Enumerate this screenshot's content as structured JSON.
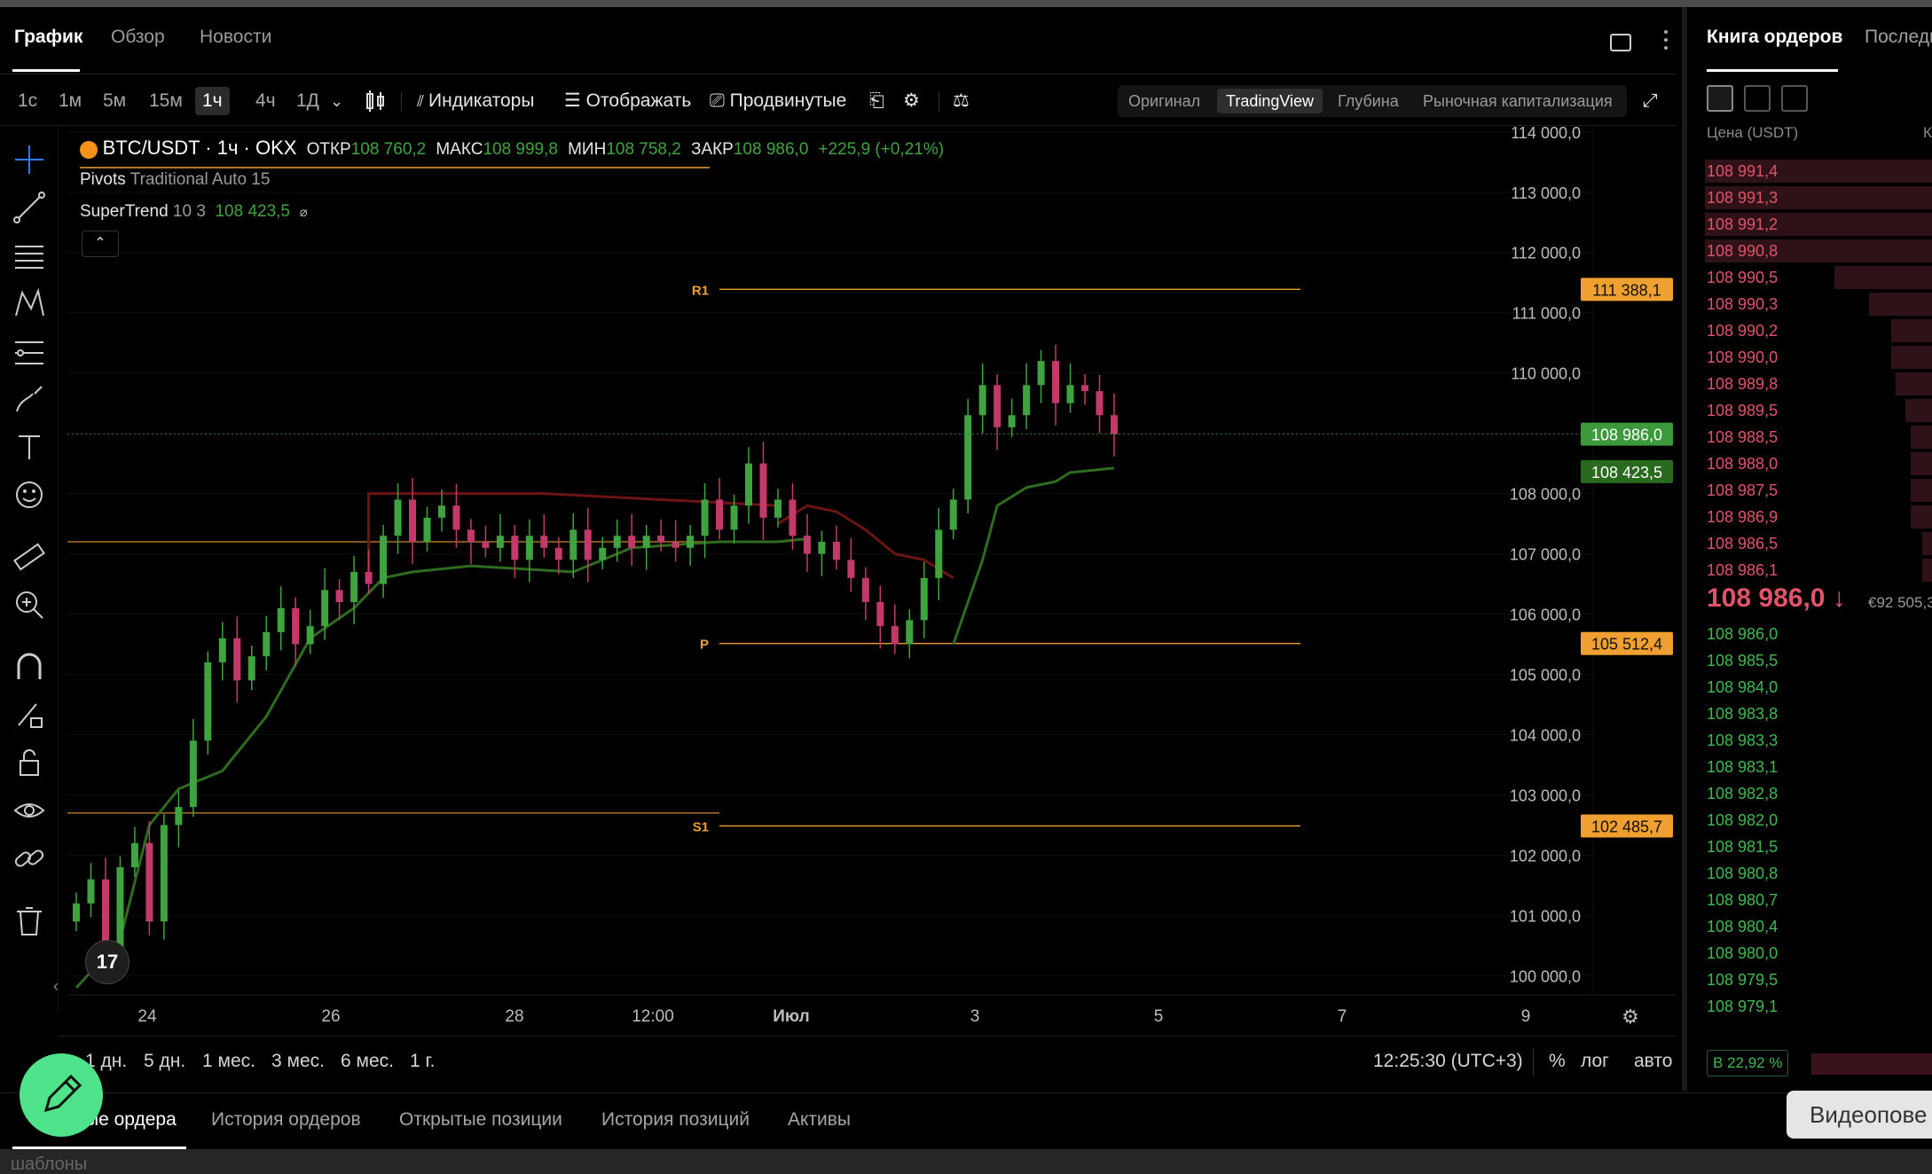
{
  "header": {
    "tabs": [
      {
        "label": "График"
      },
      {
        "label": "Обзор"
      },
      {
        "label": "Новости"
      }
    ]
  },
  "toolbar": {
    "timeframes": [
      "1с",
      "1м",
      "5м",
      "15м",
      "1ч",
      "4ч",
      "1Д"
    ],
    "active_timeframe": "1ч",
    "indicators_label": "Индикаторы",
    "display_label": "Отображать",
    "advanced_label": "Продвинутые",
    "views": [
      "Оригинал",
      "TradingView",
      "Глубина",
      "Рыночная капитализация"
    ],
    "active_view": "TradingView"
  },
  "legend": {
    "symbol": "BTC/USDT · 1ч · OKX",
    "open_label": "ОТКР",
    "open": "108 760,2",
    "high_label": "МАКС",
    "high": "108 999,8",
    "low_label": "МИН",
    "low": "108 758,2",
    "close_label": "ЗАКР",
    "close": "108 986,0",
    "change": "+225,9 (+0,21%)",
    "pivots_name": "Pivots",
    "pivots_params": "Traditional Auto 15",
    "supertrend_name": "SuperTrend",
    "supertrend_params": "10 3",
    "supertrend_value": "108 423,5",
    "supertrend_flag": "⌀",
    "collapse_glyph": "⌃",
    "logo_text": "17"
  },
  "chart_data": {
    "type": "line",
    "title": "BTC/USDT · 1ч · OKX",
    "x_tick_labels": [
      "24",
      "26",
      "28",
      "12:00",
      "Июл",
      "3",
      "5",
      "7",
      "9"
    ],
    "y_ticks": [
      100000,
      101000,
      102000,
      103000,
      104000,
      105000,
      106000,
      107000,
      108000,
      109000,
      110000,
      111000,
      112000,
      113000,
      114000
    ],
    "y_tick_labels": [
      "100 000,0",
      "101 000,0",
      "102 000,0",
      "103 000,0",
      "104 000,0",
      "105 000,0",
      "106 000,0",
      "107 000,0",
      "108 000,0",
      "",
      "110 000,0",
      "111 000,0",
      "112 000,0",
      "113 000,0",
      "114 000,0"
    ],
    "ylim": [
      99800,
      114100
    ],
    "candle_series": {
      "name": "BTC/USDT",
      "points": [
        [
          0,
          101200
        ],
        [
          1,
          101600
        ],
        [
          2,
          100400
        ],
        [
          3,
          101800
        ],
        [
          4,
          102200
        ],
        [
          5,
          100900
        ],
        [
          6,
          102500
        ],
        [
          7,
          102800
        ],
        [
          8,
          103900
        ],
        [
          9,
          105200
        ],
        [
          10,
          105600
        ],
        [
          11,
          104900
        ],
        [
          12,
          105300
        ],
        [
          13,
          105700
        ],
        [
          14,
          106100
        ],
        [
          15,
          105500
        ],
        [
          16,
          105800
        ],
        [
          17,
          106400
        ],
        [
          18,
          106200
        ],
        [
          19,
          106700
        ],
        [
          20,
          106500
        ],
        [
          21,
          107300
        ],
        [
          22,
          107900
        ],
        [
          23,
          107200
        ],
        [
          24,
          107600
        ],
        [
          25,
          107800
        ],
        [
          26,
          107400
        ],
        [
          27,
          107200
        ],
        [
          28,
          107100
        ],
        [
          29,
          107300
        ],
        [
          30,
          106900
        ],
        [
          31,
          107300
        ],
        [
          32,
          107100
        ],
        [
          33,
          106900
        ],
        [
          34,
          107400
        ],
        [
          35,
          106900
        ],
        [
          36,
          107100
        ],
        [
          37,
          107300
        ],
        [
          38,
          107100
        ],
        [
          39,
          107300
        ],
        [
          40,
          107200
        ],
        [
          41,
          107100
        ],
        [
          42,
          107300
        ],
        [
          43,
          107900
        ],
        [
          44,
          107400
        ],
        [
          45,
          107800
        ],
        [
          46,
          108500
        ],
        [
          47,
          107600
        ],
        [
          48,
          107900
        ],
        [
          49,
          107300
        ],
        [
          50,
          107000
        ],
        [
          51,
          107200
        ],
        [
          52,
          106900
        ],
        [
          53,
          106600
        ],
        [
          54,
          106200
        ],
        [
          55,
          105800
        ],
        [
          56,
          105500
        ],
        [
          57,
          105900
        ],
        [
          58,
          106600
        ],
        [
          59,
          107400
        ],
        [
          60,
          107900
        ],
        [
          61,
          109300
        ],
        [
          62,
          109800
        ],
        [
          63,
          109100
        ],
        [
          64,
          109300
        ],
        [
          65,
          109800
        ],
        [
          66,
          110200
        ],
        [
          67,
          109500
        ],
        [
          68,
          109800
        ],
        [
          69,
          109700
        ],
        [
          70,
          109300
        ],
        [
          71,
          108986
        ]
      ]
    },
    "supertrend_series": {
      "name": "SuperTrend",
      "up_points": [
        [
          0,
          99800
        ],
        [
          3,
          100600
        ],
        [
          5,
          102500
        ],
        [
          7,
          103100
        ],
        [
          10,
          103400
        ],
        [
          13,
          104300
        ],
        [
          16,
          105600
        ],
        [
          19,
          106100
        ],
        [
          21,
          106600
        ],
        [
          23,
          106700
        ],
        [
          27,
          106800
        ],
        [
          34,
          106700
        ],
        [
          38,
          107100
        ],
        [
          44,
          107200
        ],
        [
          48,
          107200
        ],
        [
          50,
          107250
        ]
      ],
      "down_points": [
        [
          48,
          107500
        ],
        [
          50,
          107800
        ],
        [
          52,
          107700
        ],
        [
          54,
          107400
        ],
        [
          56,
          107000
        ],
        [
          58,
          106900
        ],
        [
          60,
          106600
        ]
      ],
      "up_points_2": [
        [
          60,
          105500
        ],
        [
          61,
          106200
        ],
        [
          62,
          106900
        ],
        [
          63,
          107800
        ],
        [
          65,
          108100
        ],
        [
          67,
          108200
        ],
        [
          68,
          108350
        ],
        [
          71,
          108423.5
        ]
      ],
      "pre_points": [
        [
          48,
          107800
        ],
        [
          32,
          108000
        ],
        [
          20,
          108000
        ],
        [
          20,
          106700
        ]
      ]
    },
    "pivots": [
      {
        "label": "R1",
        "value": 111388.1,
        "value_label": "111 388,1"
      },
      {
        "label": "P",
        "value": 105512.4,
        "value_label": "105 512,4"
      },
      {
        "label": "S1",
        "value": 102485.7,
        "value_label": "102 485,7"
      }
    ],
    "prev_pivot_levels": [
      107200,
      102700
    ],
    "last_price": {
      "value": 108986.0,
      "label": "108 986,0"
    },
    "supertrend_last": {
      "value": 108423.5,
      "label": "108 423,5"
    },
    "colors": {
      "up": "#3fa33f",
      "down": "#c23a6a",
      "supertrend_up": "#2f6b1f",
      "supertrend_down": "#6b1414",
      "pivot": "#f0a030"
    }
  },
  "range_bar": {
    "ranges": [
      "1 дн.",
      "5 дн.",
      "1 мес.",
      "3 мес.",
      "6 мес.",
      "1 г."
    ],
    "clock": "12:25:30 (UTC+3)",
    "percent_label": "%",
    "log_label": "лог",
    "auto_label": "авто"
  },
  "bottom_tabs": {
    "tabs": [
      "ые ордера",
      "История ордеров",
      "Открытые позиции",
      "История позиций",
      "Активы"
    ],
    "video_label": "Видеопове",
    "strip_text": "шаблоны"
  },
  "orderbook": {
    "tabs": [
      "Книга ордеров",
      "Последн"
    ],
    "col_price": "Цена (USDT)",
    "col_qty": "Ко",
    "asks": [
      {
        "price": "108 991,4",
        "depth": 0.95
      },
      {
        "price": "108 991,3",
        "depth": 0.95
      },
      {
        "price": "108 991,2",
        "depth": 0.95
      },
      {
        "price": "108 990,8",
        "depth": 0.95
      },
      {
        "price": "108 990,5",
        "depth": 0.42
      },
      {
        "price": "108 990,3",
        "depth": 0.28
      },
      {
        "price": "108 990,2",
        "depth": 0.19
      },
      {
        "price": "108 990,0",
        "depth": 0.19
      },
      {
        "price": "108 989,8",
        "depth": 0.17
      },
      {
        "price": "108 989,5",
        "depth": 0.13
      },
      {
        "price": "108 988,5",
        "depth": 0.11
      },
      {
        "price": "108 988,0",
        "depth": 0.11
      },
      {
        "price": "108 987,5",
        "depth": 0.11
      },
      {
        "price": "108 986,9",
        "depth": 0.11
      },
      {
        "price": "108 986,5",
        "depth": 0.06
      },
      {
        "price": "108 986,1",
        "depth": 0.06
      }
    ],
    "last_price": "108 986,0 ↓",
    "last_price_fiat": "€92 505,3",
    "bids": [
      "108 986,0",
      "108 985,5",
      "108 984,0",
      "108 983,8",
      "108 983,3",
      "108 983,1",
      "108 982,8",
      "108 982,0",
      "108 981,5",
      "108 980,8",
      "108 980,7",
      "108 980,4",
      "108 980,0",
      "108 979,5",
      "108 979,1"
    ],
    "ratio_side": "B",
    "ratio_value": "22,92 %"
  }
}
